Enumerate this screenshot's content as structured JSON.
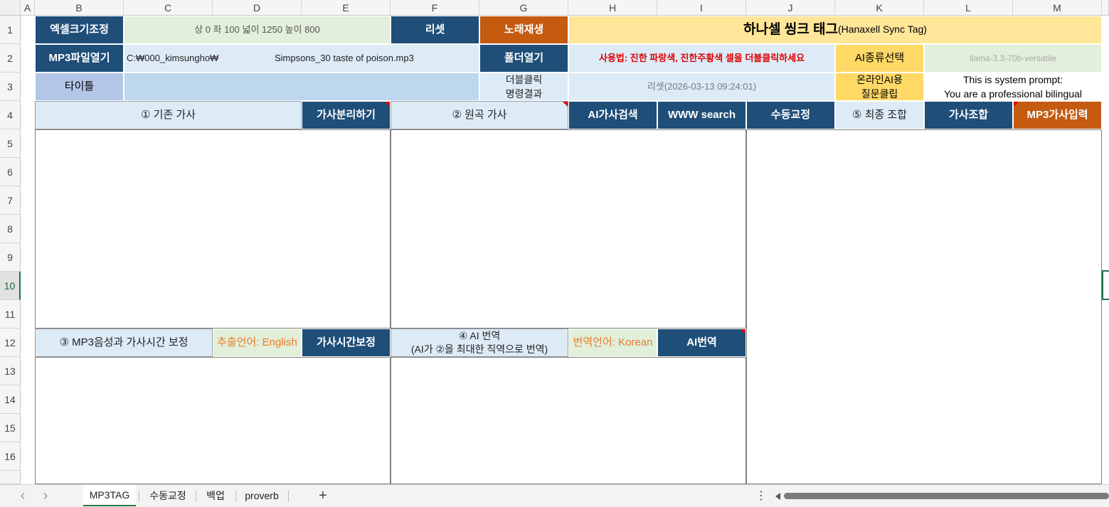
{
  "columns": [
    "A",
    "B",
    "C",
    "D",
    "E",
    "F",
    "G",
    "H",
    "I",
    "J",
    "K",
    "L",
    "M"
  ],
  "rows": [
    "1",
    "2",
    "3",
    "4",
    "5",
    "6",
    "7",
    "8",
    "9",
    "10",
    "11",
    "12",
    "13",
    "14",
    "15",
    "16"
  ],
  "row1": {
    "resize_btn": "엑셀크기조정",
    "resize_info": "상 0 좌 100 넓이 1250 높이 800",
    "reset_btn": "리셋",
    "play_btn": "노래재생",
    "app_title_main": "하나셀 씽크 태그",
    "app_title_sub": "(Hanaxell Sync Tag)"
  },
  "row2": {
    "open_mp3_btn": "MP3파일열기",
    "path": "C:₩000_kimsungho₩",
    "filename": "Simpsons_30 taste of poison.mp3",
    "open_folder_btn": "폴더열기",
    "usage_text": "사용법: 진한 파랑색, 진한주황색 셀을 더블클릭하세요",
    "ai_select_btn": "AI종류선택",
    "ai_model": "llama-3.3-70b-versatile"
  },
  "row3": {
    "title_label": "타이틀",
    "title_value": "",
    "dblclick_line1": "더블클릭",
    "dblclick_line2": "명령결과",
    "command_result": "리셋(2026-03-13 09:24:01)",
    "online_ai_line1": "온라인AI용",
    "online_ai_line2": "질문클립",
    "prompt_line1": "This is system prompt:",
    "prompt_line2": "You are a professional bilingual"
  },
  "row4": {
    "existing_lyrics": "① 기존 가사",
    "split_lyrics_btn": "가사분리하기",
    "original_lyrics": "② 원곡 가사",
    "ai_search_btn": "AI가사검색",
    "www_search_btn": "WWW search",
    "manual_edit_btn": "수동교정",
    "final_combo": "⑤ 최종 조합",
    "combine_btn": "가사조합",
    "mp3_input_btn": "MP3가사입력"
  },
  "row12": {
    "sync_label": "③ MP3음성과 가사시간 보정",
    "extract_lang": "추출언어: English",
    "time_fix_btn": "가사시간보정",
    "ai_translate_line1": "④ AI 번역",
    "ai_translate_line2": "(AI가 ②을 최대한 직역으로 번역)",
    "translate_lang": "번역언어: Korean",
    "ai_translate_btn": "AI번역"
  },
  "sheet_tabs": [
    "MP3TAG",
    "수동교정",
    "백업",
    "proverb"
  ],
  "active_tab": "MP3TAG",
  "add_sheet": "+",
  "nav_prev": "‹",
  "nav_next": "›",
  "more_options": "⋮",
  "colors": {
    "navy": "#1f4e79",
    "orange": "#c55a11",
    "light_blue": "#ddebf7",
    "light_green": "#e2efda",
    "gold": "#ffe699",
    "red_text": "#e00000",
    "orange_text": "#e97d2a"
  }
}
